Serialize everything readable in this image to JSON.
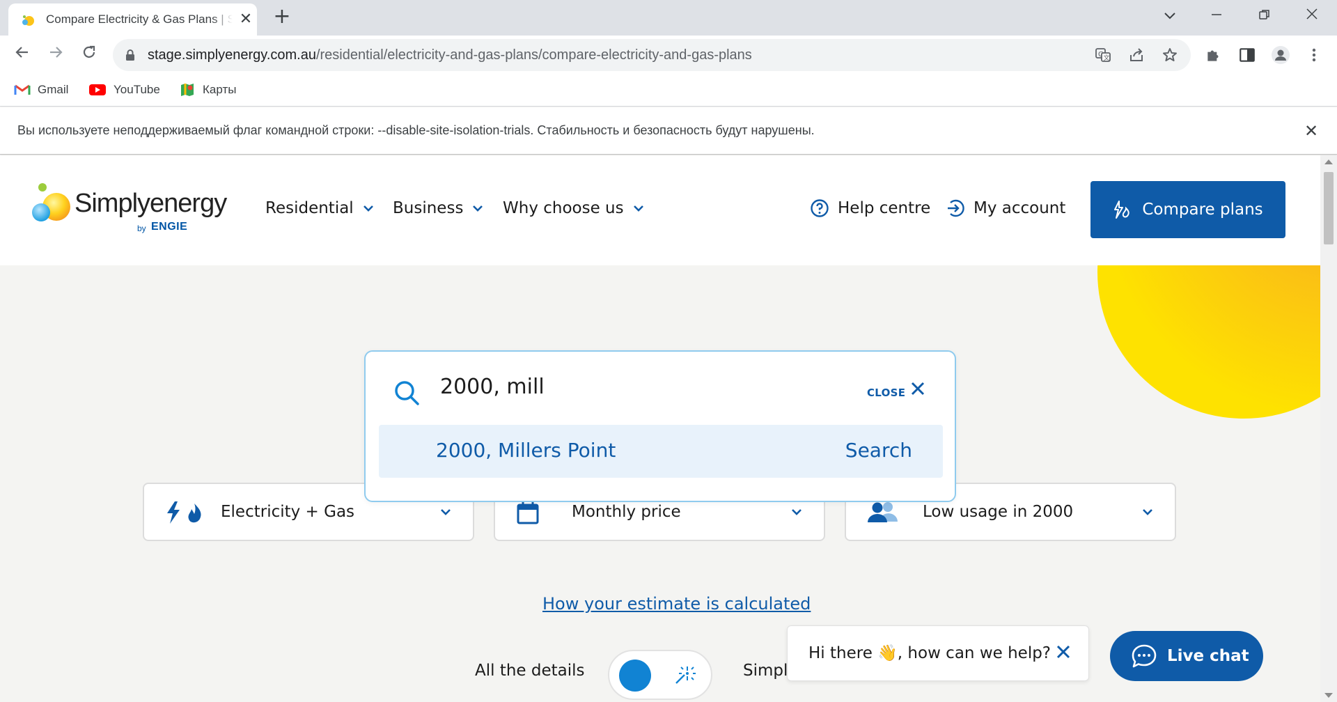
{
  "browser": {
    "tab_title": "Compare Electricity & Gas Plans | Simply Energy",
    "tab_close": "✕",
    "new_tab": "+",
    "url_host": "stage.simplyenergy.com.au",
    "url_path": "/residential/electricity-and-gas-plans/compare-electricity-and-gas-plans",
    "bookmarks": [
      {
        "label": "Gmail",
        "icon": "gmail-icon"
      },
      {
        "label": "YouTube",
        "icon": "youtube-icon"
      },
      {
        "label": "Карты",
        "icon": "maps-icon"
      }
    ],
    "infobar_text": "Вы используете неподдерживаемый флаг командной строки: --disable-site-isolation-trials. Стабильность и безопасность будут нарушены.",
    "infobar_close": "✕"
  },
  "site": {
    "logo_word": "Simplyenergy",
    "logo_by": "by",
    "logo_brand": "ENGIE",
    "nav": [
      "Residential",
      "Business",
      "Why choose us"
    ],
    "help_centre": "Help centre",
    "my_account": "My account",
    "cta": "Compare plans"
  },
  "search": {
    "value": "2000, mill",
    "close_label": "CLOSE",
    "suggestion": "2000, Millers Point",
    "suggestion_action": "Search"
  },
  "selectors": [
    {
      "label": "Electricity + Gas",
      "icon": "bolt-flame-icon"
    },
    {
      "label": "Monthly price",
      "icon": "calendar-icon"
    },
    {
      "label": "Low usage in 2000",
      "icon": "people-icon"
    }
  ],
  "estimate_link": "How your estimate is calculated",
  "toggle": {
    "left_label": "All the details",
    "right_label": "Simpli"
  },
  "chat": {
    "greeting": "Hi there 👋, how can we help?",
    "live_chat": "Live chat"
  },
  "colors": {
    "brand_blue": "#0f5ba8",
    "accent_blue": "#1183d3",
    "sun_yellow": "#fee200",
    "suggestion_bg": "#e8f2fb"
  }
}
